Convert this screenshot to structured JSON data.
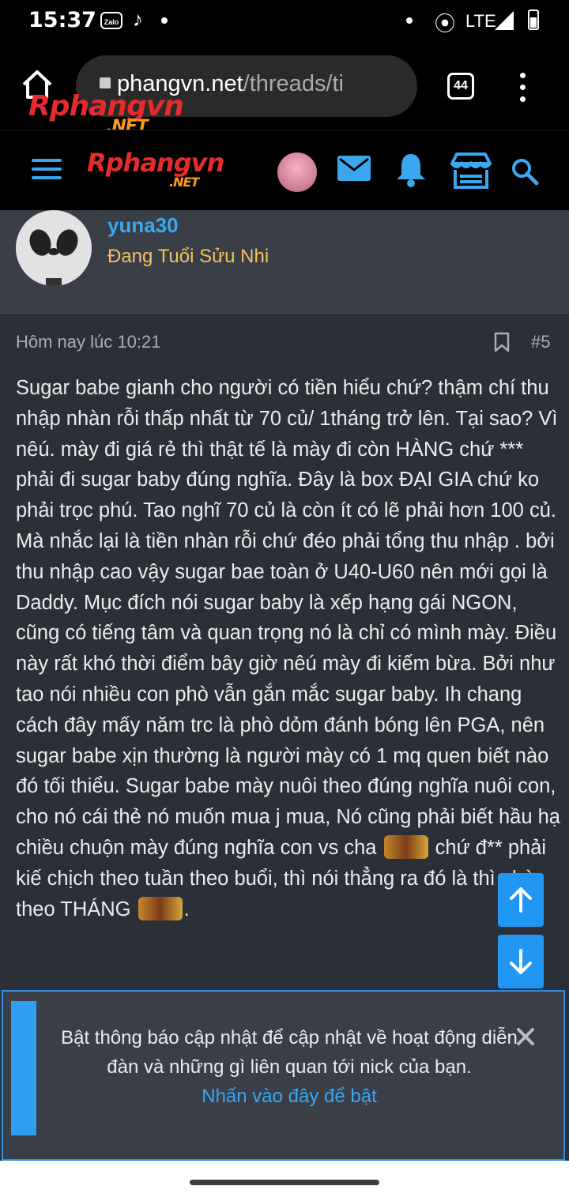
{
  "status_bar": {
    "time": "15:37",
    "zalo_label": "Zalo",
    "network": "LTE",
    "icons": [
      "zalo-icon",
      "tiktok-icon",
      "notification-dot-icon",
      "hotspot-icon",
      "signal-icon",
      "battery-icon"
    ]
  },
  "browser": {
    "url_host": "rphangvn.net",
    "url_path": "/threads/ti",
    "url_host_visible": "phangvn.net",
    "tab_count": "44",
    "overlay_logo": "Rphangvn",
    "overlay_logo_net": ".NET"
  },
  "site_header": {
    "logo": "Rphangvn",
    "logo_net": ".NET",
    "icons": [
      "menu-icon",
      "mail-icon",
      "bell-icon",
      "store-icon",
      "search-icon"
    ],
    "accent_color": "#3aa7ef"
  },
  "user": {
    "name": "yuna30",
    "title": "Đang Tuổi Sửu Nhi"
  },
  "post": {
    "timestamp": "Hôm nay lúc 10:21",
    "number": "#5",
    "body_part1": "Sugar babe gianh cho người có tiền hiểu chứ? thậm chí thu nhập nhàn rỗi thấp nhất từ 70 củ/ 1tháng trở lên. Tại sao? Vì nêú. mày đi giá rẻ thì thật tế là mày đi còn HÀNG chứ *** phải đi sugar baby đúng nghĩa. Đây là box ĐẠI GIA chứ ko phải trọc phú. Tao nghĩ 70 củ là còn ít có lẽ phải hơn 100 củ. Mà nhắc lại là tiền nhàn rỗi chứ đéo phải tổng thu nhập . bởi thu nhập cao vậy sugar bae toàn ở U40-U60 nên mới gọi là Daddy. Mục đích nói sugar baby là xếp hạng gái NGON, cũng có tiếng tâm và quan trọng nó là chỉ có mình mày. Điều này rất khó thời điểm bây giờ nêú mày đi kiếm bừa. Bởi như tao nói nhiều con phò vẫn gắn mắc sugar baby. Ih chang cách đây mấy năm trc là phò dỏm đánh bóng lên PGA, nên sugar babe xịn thường là người mày có 1 mq quen biết nào đó tối thiểu. Sugar babe mày nuôi theo đúng nghĩa nuôi con, cho nó cái thẻ nó muốn mua j mua, Nó cũng phải biết hầu hạ chiều chuộn mày đúng nghĩa con vs cha",
    "body_part2": "chứ đ** phải kiế chịch theo tuần theo buổi, thì nói thẳng ra đó là thì phò theo THÁNG",
    "body_part3": "."
  },
  "notification": {
    "message": "Bật thông báo cập nhật để cập nhật về hoạt động diễn đàn và những gì liên quan tới nick của bạn.",
    "link_text": "Nhấn vào đây để bật"
  }
}
